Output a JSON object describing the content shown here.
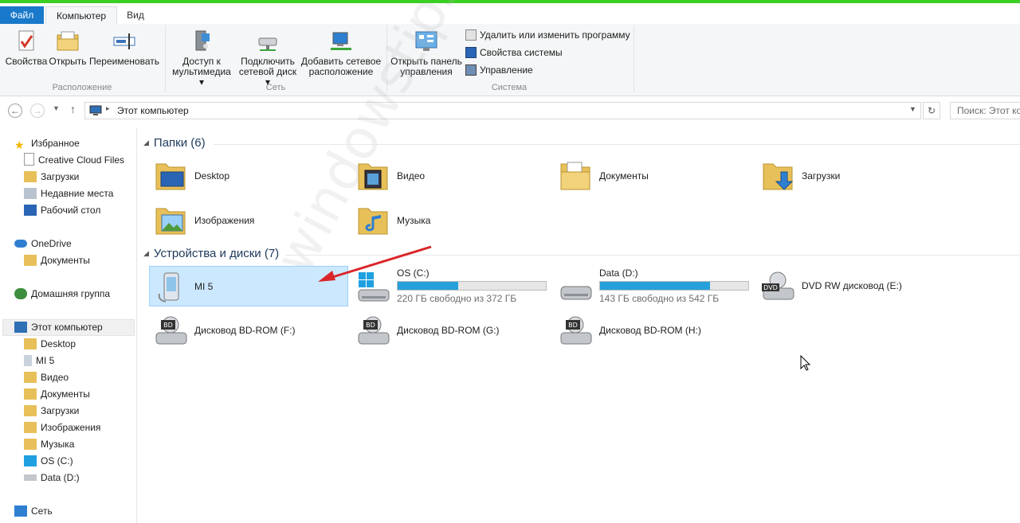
{
  "tabs": {
    "file": "Файл",
    "computer": "Компьютер",
    "view": "Вид"
  },
  "ribbon": {
    "location": {
      "label": "Расположение",
      "properties": "Свойства",
      "open": "Открыть",
      "rename": "Переименовать"
    },
    "network": {
      "label": "Сеть",
      "media_l1": "Доступ к",
      "media_l2": "мультимедиа",
      "map_l1": "Подключить",
      "map_l2": "сетевой диск",
      "add_l1": "Добавить сетевое",
      "add_l2": "расположение"
    },
    "system": {
      "label": "Система",
      "cp_l1": "Открыть панель",
      "cp_l2": "управления",
      "uninstall": "Удалить или изменить программу",
      "sysprops": "Свойства системы",
      "manage": "Управление"
    }
  },
  "address": {
    "path": "Этот компьютер",
    "search_placeholder": "Поиск: Этот компьютер"
  },
  "nav": {
    "favorites": "Избранное",
    "creative_cloud": "Creative Cloud Files",
    "downloads": "Загрузки",
    "recent": "Недавние места",
    "desktop": "Рабочий стол",
    "onedrive": "OneDrive",
    "onedrive_docs": "Документы",
    "homegroup": "Домашняя группа",
    "this_pc": "Этот компьютер",
    "pc_items": [
      "Desktop",
      "MI 5",
      "Видео",
      "Документы",
      "Загрузки",
      "Изображения",
      "Музыка",
      "OS (C:)",
      "Data (D:)"
    ],
    "network": "Сеть"
  },
  "folders": {
    "title": "Папки (6)",
    "items": [
      "Desktop",
      "Видео",
      "Документы",
      "Загрузки",
      "Изображения",
      "Музыка"
    ]
  },
  "devices": {
    "title": "Устройства и диски (7)",
    "mi5": "MI 5",
    "c": {
      "name": "OS (C:)",
      "free": "220 ГБ свободно из 372 ГБ",
      "used_fraction": 0.41
    },
    "d": {
      "name": "Data (D:)",
      "free": "143 ГБ свободно из 542 ГБ",
      "used_fraction": 0.74
    },
    "dvd": "DVD RW дисковод (E:)",
    "bd_f": "Дисковод BD-ROM (F:)",
    "bd_g": "Дисковод BD-ROM (G:)",
    "bd_h": "Дисковод BD-ROM (H:)",
    "bd_badge": "BD",
    "dvd_badge": "DVD"
  },
  "watermark": "windowstips.ru",
  "colors": {
    "accent": "#1979ca",
    "selection": "#cce8ff",
    "bar": "#26a0da",
    "arrow": "#d9262a"
  }
}
